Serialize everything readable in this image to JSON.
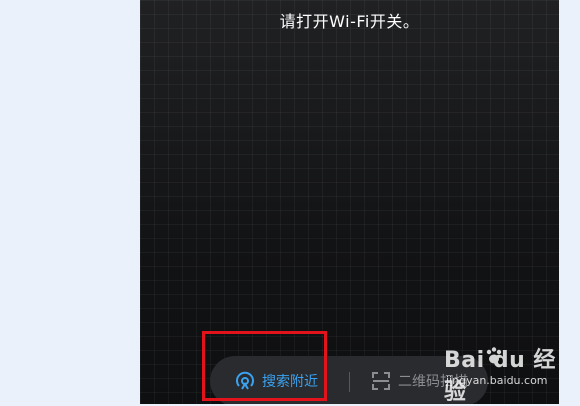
{
  "screen": {
    "instruction": "请打开Wi-Fi开关。"
  },
  "bottom_bar": {
    "nearby_label": "搜索附近",
    "qr_label": "二维码扫描"
  },
  "watermark": {
    "logo_text": "Bai du 经验",
    "url": "jingyan.baidu.com"
  },
  "colors": {
    "accent": "#3aa2f0",
    "highlight": "#e3131b",
    "screen_bg": "#141517"
  },
  "icons": {
    "nearby": "radar-icon",
    "qr": "scan-frame-icon",
    "watermark": "paw-icon"
  }
}
